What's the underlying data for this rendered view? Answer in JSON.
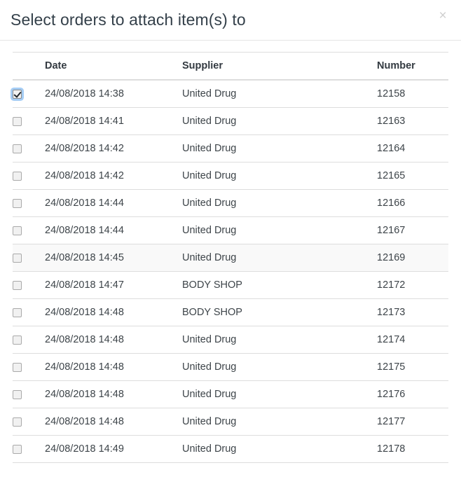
{
  "modal": {
    "title": "Select orders to attach item(s) to",
    "close_label": "×",
    "close_icon": "close-icon"
  },
  "table": {
    "columns": [
      {
        "key": "check",
        "label": ""
      },
      {
        "key": "date",
        "label": "Date"
      },
      {
        "key": "supplier",
        "label": "Supplier"
      },
      {
        "key": "number",
        "label": "Number"
      }
    ],
    "rows": [
      {
        "checked": true,
        "hovered": false,
        "date": "24/08/2018 14:38",
        "supplier": "United Drug",
        "number": "12158"
      },
      {
        "checked": false,
        "hovered": false,
        "date": "24/08/2018 14:41",
        "supplier": "United Drug",
        "number": "12163"
      },
      {
        "checked": false,
        "hovered": false,
        "date": "24/08/2018 14:42",
        "supplier": "United Drug",
        "number": "12164"
      },
      {
        "checked": false,
        "hovered": false,
        "date": "24/08/2018 14:42",
        "supplier": "United Drug",
        "number": "12165"
      },
      {
        "checked": false,
        "hovered": false,
        "date": "24/08/2018 14:44",
        "supplier": "United Drug",
        "number": "12166"
      },
      {
        "checked": false,
        "hovered": false,
        "date": "24/08/2018 14:44",
        "supplier": "United Drug",
        "number": "12167"
      },
      {
        "checked": false,
        "hovered": true,
        "date": "24/08/2018 14:45",
        "supplier": "United Drug",
        "number": "12169"
      },
      {
        "checked": false,
        "hovered": false,
        "date": "24/08/2018 14:47",
        "supplier": "BODY SHOP",
        "number": "12172"
      },
      {
        "checked": false,
        "hovered": false,
        "date": "24/08/2018 14:48",
        "supplier": "BODY SHOP",
        "number": "12173"
      },
      {
        "checked": false,
        "hovered": false,
        "date": "24/08/2018 14:48",
        "supplier": "United Drug",
        "number": "12174"
      },
      {
        "checked": false,
        "hovered": false,
        "date": "24/08/2018 14:48",
        "supplier": "United Drug",
        "number": "12175"
      },
      {
        "checked": false,
        "hovered": false,
        "date": "24/08/2018 14:48",
        "supplier": "United Drug",
        "number": "12176"
      },
      {
        "checked": false,
        "hovered": false,
        "date": "24/08/2018 14:48",
        "supplier": "United Drug",
        "number": "12177"
      },
      {
        "checked": false,
        "hovered": false,
        "date": "24/08/2018 14:49",
        "supplier": "United Drug",
        "number": "12178"
      }
    ]
  },
  "colors": {
    "title_text": "#34404a",
    "header_text": "#333a41",
    "date_text": "#3d4449",
    "supplier_text": "#5f6b74",
    "number_text": "#3d4449",
    "border": "#dddddd",
    "row_hover_bg": "#f9f9f9",
    "checkbox_focus_ring": "#a5cdf5",
    "close_icon": "#cfcfcf",
    "background": "#ffffff"
  }
}
